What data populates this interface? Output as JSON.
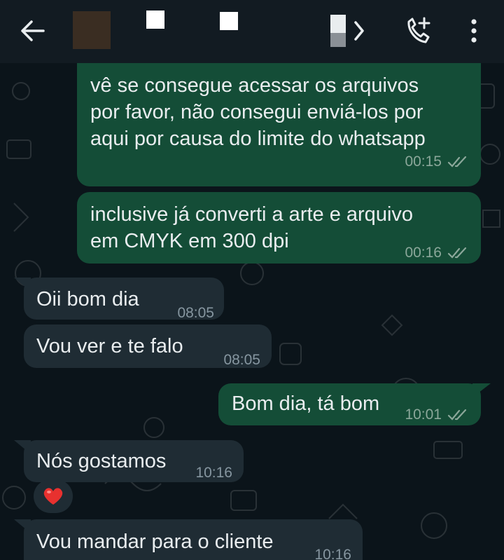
{
  "header": {
    "contact_name": "",
    "status": ""
  },
  "messages": [
    {
      "direction": "outgoing",
      "text": "vê se consegue acessar os arquivos\npor favor, não consegui enviá-los por\naqui por causa do limite do whatsapp",
      "time": "00:15",
      "read": true
    },
    {
      "direction": "outgoing",
      "text": "inclusive já converti a arte e arquivo\nem CMYK em 300 dpi",
      "time": "00:16",
      "read": true
    },
    {
      "direction": "incoming",
      "text": "Oii bom dia",
      "time": "08:05"
    },
    {
      "direction": "incoming",
      "text": "Vou ver e te falo",
      "time": "08:05"
    },
    {
      "direction": "outgoing",
      "text": "Bom dia, tá bom",
      "time": "10:01",
      "read": true
    },
    {
      "direction": "incoming",
      "text": "Nós gostamos",
      "time": "10:16",
      "reaction": "❤️"
    },
    {
      "direction": "incoming",
      "text": "Vou mandar para o cliente",
      "time": "10:16"
    }
  ],
  "colors": {
    "outgoing_bubble": "#144d37",
    "incoming_bubble": "#1f2c34",
    "background": "#0b141a",
    "read_ticks": "#8ba79a"
  },
  "icons": [
    "back-arrow-icon",
    "video-call-icon",
    "add-call-icon",
    "more-options-icon",
    "double-check-icon",
    "heart-icon"
  ]
}
